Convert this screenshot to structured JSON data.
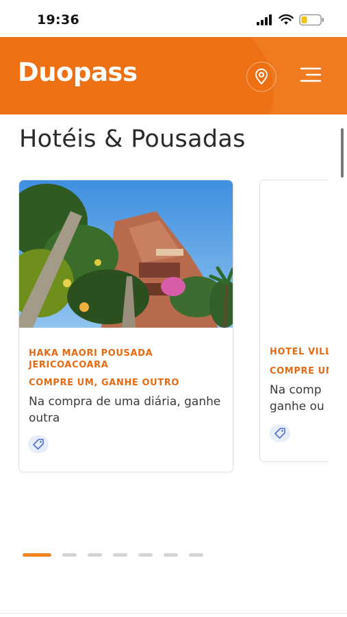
{
  "status_bar": {
    "time": "19:36",
    "icons": [
      "signal-icon",
      "wifi-icon",
      "battery-icon"
    ]
  },
  "header": {
    "logo": "Duopass",
    "brand_color": "#f07a20",
    "icons": [
      "location-pin-icon",
      "hamburger-menu-icon"
    ]
  },
  "section": {
    "title": "Hotéis & Pousadas"
  },
  "cards": [
    {
      "name": "HAKA MAORI POUSADA JERICOACOARA",
      "offer": "COMPRE UM, GANHE OUTRO",
      "description": "Na compra de uma diária, ganhe outra",
      "icon": "tag-icon"
    },
    {
      "name": "HOTEL VILL",
      "offer": "COMPRE UM",
      "description": "Na comp ganhe ou",
      "icon": "tag-icon"
    }
  ],
  "pagination": {
    "total": 7,
    "active_index": 0,
    "active_color": "#f0841f"
  }
}
